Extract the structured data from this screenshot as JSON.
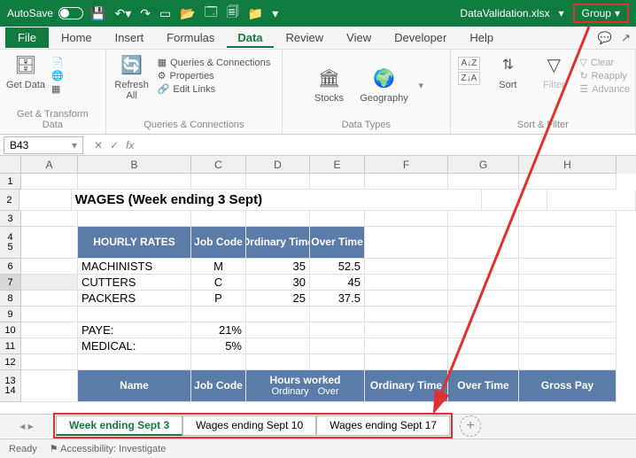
{
  "titlebar": {
    "autosave": "AutoSave",
    "filename": "DataValidation.xlsx",
    "group_btn": "Group"
  },
  "tabs": {
    "file": "File",
    "home": "Home",
    "insert": "Insert",
    "formulas": "Formulas",
    "data": "Data",
    "review": "Review",
    "view": "View",
    "developer": "Developer",
    "help": "Help"
  },
  "ribbon": {
    "get_data": "Get Data",
    "refresh_all": "Refresh All",
    "queries_conn": "Queries & Connections",
    "properties": "Properties",
    "edit_links": "Edit Links",
    "stocks": "Stocks",
    "geography": "Geography",
    "sort": "Sort",
    "filter": "Filter",
    "clear": "Clear",
    "reapply": "Reapply",
    "advanced": "Advance",
    "grp_get": "Get & Transform Data",
    "grp_queries": "Queries & Connections",
    "grp_types": "Data Types",
    "grp_sort": "Sort & Filter"
  },
  "namebox": "B43",
  "cols": [
    "A",
    "B",
    "C",
    "D",
    "E",
    "F",
    "G",
    "H"
  ],
  "rows": [
    "1",
    "2",
    "3",
    "4",
    "5",
    "6",
    "7",
    "8",
    "9",
    "10",
    "11",
    "12",
    "13",
    "14"
  ],
  "cells": {
    "title": "WAGES (Week ending 3 Sept)",
    "hdr1_rates": "HOURLY RATES",
    "hdr1_code": "Job Code",
    "hdr1_ord": "Ordinary Time",
    "hdr1_over": "Over Time",
    "r6_b": "MACHINISTS",
    "r6_c": "M",
    "r6_d": "35",
    "r6_e": "52.5",
    "r7_b": "CUTTERS",
    "r7_c": "C",
    "r7_d": "30",
    "r7_e": "45",
    "r8_b": "PACKERS",
    "r8_c": "P",
    "r8_d": "25",
    "r8_e": "37.5",
    "r10_b": "PAYE:",
    "r10_c": "21%",
    "r11_b": "MEDICAL:",
    "r11_c": "5%",
    "hdr2_name": "Name",
    "hdr2_code": "Job Code",
    "hdr2_hours": "Hours worked",
    "hdr2_hours_o": "Ordinary",
    "hdr2_hours_ov": "Over",
    "hdr2_ord": "Ordinary Time",
    "hdr2_over": "Over Time",
    "hdr2_gross": "Gross Pay"
  },
  "sheets": {
    "s1": "Week ending Sept 3",
    "s2": "Wages ending Sept 10",
    "s3": "Wages ending Sept 17"
  },
  "status": {
    "ready": "Ready",
    "access": "Accessibility: Investigate"
  }
}
